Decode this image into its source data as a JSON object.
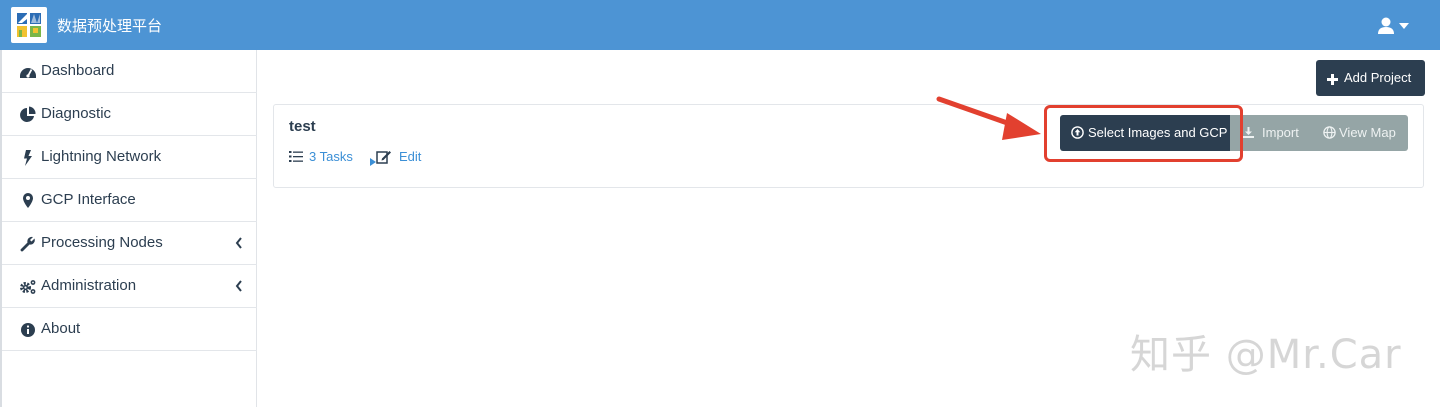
{
  "header": {
    "app_title": "数据预处理平台",
    "bg_color": "#4d94d4"
  },
  "sidebar": {
    "items": [
      {
        "label": "Dashboard",
        "icon": "tachometer-icon"
      },
      {
        "label": "Diagnostic",
        "icon": "pie-chart-icon"
      },
      {
        "label": "Lightning Network",
        "icon": "bolt-icon"
      },
      {
        "label": "GCP Interface",
        "icon": "map-marker-icon"
      },
      {
        "label": "Processing Nodes",
        "icon": "wrench-icon",
        "has_submenu": true
      },
      {
        "label": "Administration",
        "icon": "cogs-icon",
        "has_submenu": true
      },
      {
        "label": "About",
        "icon": "info-circle-icon"
      }
    ]
  },
  "main": {
    "add_project_label": "Add Project",
    "project": {
      "name": "test",
      "tasks_label": "3 Tasks",
      "edit_label": "Edit",
      "select_images_label": "Select Images and GCP",
      "import_label": "Import",
      "view_map_label": "View Map"
    }
  },
  "annotation": {
    "highlight_color": "#e2402f"
  },
  "watermark": {
    "text": "知乎 @Mr.Car"
  },
  "colors": {
    "primary_dark": "#2c3e50",
    "link": "#3b8fd6",
    "secondary_button": "#95a5a6"
  }
}
